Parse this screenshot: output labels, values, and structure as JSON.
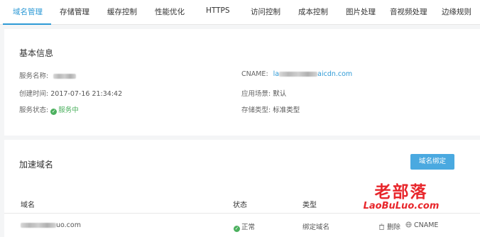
{
  "tabs": [
    "域名管理",
    "存储管理",
    "缓存控制",
    "性能优化",
    "HTTPS",
    "访问控制",
    "成本控制",
    "图片处理",
    "音视频处理",
    "边缘规则"
  ],
  "active_tab_index": 0,
  "basic": {
    "title": "基本信息",
    "service_name_label": "服务名称:",
    "created_label": "创建时间:",
    "created_value": "2017-07-16 21:34:42",
    "status_label": "服务状态:",
    "status_value": "服务中",
    "cname_label": "CNAME:",
    "cname_prefix": "la",
    "cname_suffix": "aicdn.com",
    "scene_label": "应用场景:",
    "scene_value": "默认",
    "storage_label": "存储类型:",
    "storage_value": "标准类型"
  },
  "domains": {
    "title": "加速域名",
    "bind_button": "域名绑定",
    "columns": [
      "域名",
      "状态",
      "类型"
    ],
    "rows": [
      {
        "domain_suffix": "uo.com",
        "status": "正常",
        "type": "绑定域名",
        "actions": [
          "删除",
          "CNAME"
        ]
      }
    ]
  },
  "watermark": {
    "cn": "老部落",
    "en": "LaoBuLuo.com"
  },
  "colors": {
    "accent": "#2e9ad6",
    "success": "#4bb05e",
    "button": "#4aa9e0",
    "watermark": "#e8262b"
  }
}
